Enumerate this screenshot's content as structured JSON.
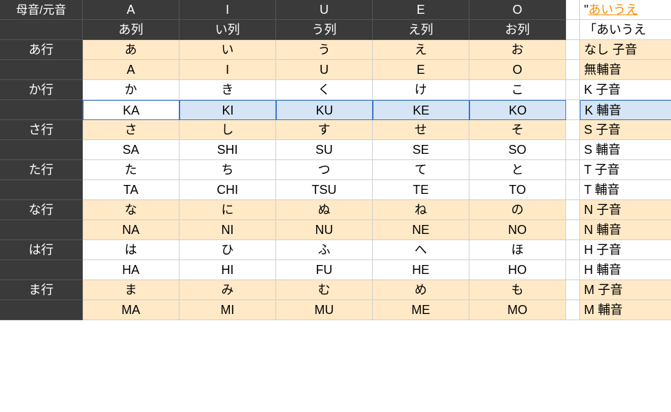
{
  "corner": "母音/元音",
  "colHeaders1": [
    "A",
    "I",
    "U",
    "E",
    "O"
  ],
  "colHeaders2": [
    "あ列",
    "い列",
    "う列",
    "え列",
    "お列"
  ],
  "topRight1": "\"あいうえ",
  "topRight2": "「あいうえ",
  "rows": [
    {
      "label": "あ行",
      "kana": [
        "あ",
        "い",
        "う",
        "え",
        "お"
      ],
      "right_kana": "なし 子音",
      "romaji": [
        "A",
        "I",
        "U",
        "E",
        "O"
      ],
      "right_romaji": "無輔音",
      "kana_peach": true,
      "romaji_peach": true
    },
    {
      "label": "か行",
      "kana": [
        "か",
        "き",
        "く",
        "け",
        "こ"
      ],
      "right_kana": "K 子音",
      "romaji": [
        "KA",
        "KI",
        "KU",
        "KE",
        "KO"
      ],
      "right_romaji": "K 輔音",
      "kana_peach": false,
      "romaji_peach": false,
      "romaji_selected": true
    },
    {
      "label": "さ行",
      "kana": [
        "さ",
        "し",
        "す",
        "せ",
        "そ"
      ],
      "right_kana": "S 子音",
      "romaji": [
        "SA",
        "SHI",
        "SU",
        "SE",
        "SO"
      ],
      "right_romaji": "S 輔音",
      "kana_peach": true,
      "romaji_peach": false
    },
    {
      "label": "た行",
      "kana": [
        "た",
        "ち",
        "つ",
        "て",
        "と"
      ],
      "right_kana": "T 子音",
      "romaji": [
        "TA",
        "CHI",
        "TSU",
        "TE",
        "TO"
      ],
      "right_romaji": "T 輔音",
      "kana_peach": false,
      "romaji_peach": false
    },
    {
      "label": "な行",
      "kana": [
        "な",
        "に",
        "ぬ",
        "ね",
        "の"
      ],
      "right_kana": "N 子音",
      "romaji": [
        "NA",
        "NI",
        "NU",
        "NE",
        "NO"
      ],
      "right_romaji": "N 輔音",
      "kana_peach": true,
      "romaji_peach": true
    },
    {
      "label": "は行",
      "kana": [
        "は",
        "ひ",
        "ふ",
        "へ",
        "ほ"
      ],
      "right_kana": "H 子音",
      "romaji": [
        "HA",
        "HI",
        "FU",
        "HE",
        "HO"
      ],
      "right_romaji": "H 輔音",
      "kana_peach": false,
      "romaji_peach": false
    },
    {
      "label": "ま行",
      "kana": [
        "ま",
        "み",
        "む",
        "め",
        "も"
      ],
      "right_kana": "M 子音",
      "romaji": [
        "MA",
        "MI",
        "MU",
        "ME",
        "MO"
      ],
      "right_romaji": "M 輔音",
      "kana_peach": true,
      "romaji_peach": true
    }
  ]
}
